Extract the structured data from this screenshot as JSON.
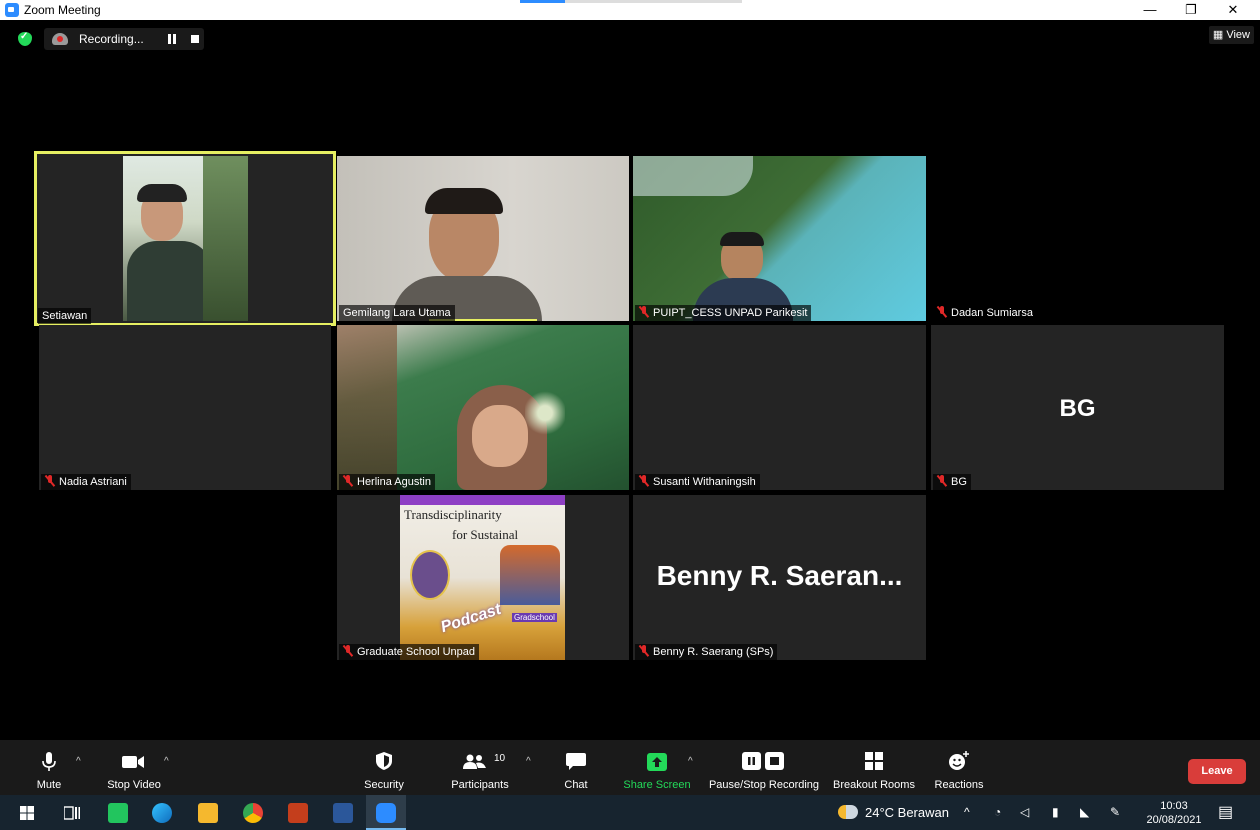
{
  "window": {
    "title": "Zoom Meeting",
    "minimize": "—",
    "maximize": "❐",
    "close": "✕"
  },
  "recording": {
    "label": "Recording..."
  },
  "view": {
    "label": "View"
  },
  "tiles": [
    {
      "name": "Setiawan"
    },
    {
      "name": "Gemilang Lara Utama"
    },
    {
      "name": "PUIPT_CESS UNPAD Parikesit"
    },
    {
      "name": "Dadan Sumiarsa"
    },
    {
      "name": "Nadia Astriani"
    },
    {
      "name": "Herlina Agustin"
    },
    {
      "name": "Susanti Withaningsih"
    },
    {
      "name": "BG",
      "initial": "BG"
    },
    {
      "name": "Graduate School Unpad"
    },
    {
      "name": "Benny R. Saerang (SPs)",
      "display": "Benny R. Saeran..."
    }
  ],
  "poster": {
    "line1": "Transdisciplinarity",
    "line2": "for Sustainal",
    "stamp": "Podcast",
    "tag": "Gradschool"
  },
  "toolbar": {
    "mute": "Mute",
    "stop_video": "Stop Video",
    "security": "Security",
    "participants": "Participants",
    "participants_count": "10",
    "chat": "Chat",
    "share_screen": "Share Screen",
    "pause_stop_recording": "Pause/Stop Recording",
    "breakout_rooms": "Breakout Rooms",
    "reactions": "Reactions",
    "leave": "Leave"
  },
  "taskbar": {
    "weather": "24°C  Berawan",
    "time": "10:03",
    "date": "20/08/2021"
  },
  "colors": {
    "accent": "#2d8cff",
    "speaker": "#e6ef62",
    "leave": "#d93d3a",
    "share": "#23d959",
    "muted": "#e02828"
  }
}
